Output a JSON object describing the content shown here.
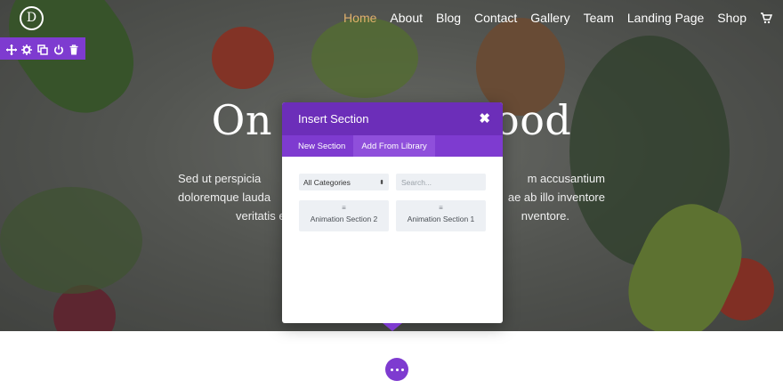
{
  "nav": {
    "items": [
      {
        "label": "Home",
        "active": true
      },
      {
        "label": "About"
      },
      {
        "label": "Blog"
      },
      {
        "label": "Contact"
      },
      {
        "label": "Gallery"
      },
      {
        "label": "Team"
      },
      {
        "label": "Landing Page"
      },
      {
        "label": "Shop"
      }
    ],
    "cart_icon": "cart-icon"
  },
  "logo": {
    "letter": "D"
  },
  "toolbar": {
    "icons": [
      "move-icon",
      "gear-icon",
      "duplicate-icon",
      "power-icon",
      "trash-icon"
    ],
    "color": "#7e3bd0"
  },
  "hero": {
    "title_left": "On",
    "title_right": "ood",
    "lines": [
      {
        "left": "Sed ut perspicia",
        "right": "m accusantium"
      },
      {
        "left": "doloremque lauda",
        "right": "ae ab illo inventore"
      },
      {
        "left": "veritatis e",
        "right": "nventore."
      }
    ]
  },
  "modal": {
    "title": "Insert Section",
    "close_icon": "close-icon",
    "tabs": [
      {
        "label": "New Section",
        "active": false
      },
      {
        "label": "Add From Library",
        "active": true
      }
    ],
    "category_select": {
      "value": "All Categories"
    },
    "search": {
      "placeholder": "Search..."
    },
    "items": [
      {
        "label": "Animation Section 2",
        "icon": "drag-handle-icon"
      },
      {
        "label": "Animation Section 1",
        "icon": "drag-handle-icon"
      }
    ],
    "header_color": "#6c2eb9",
    "tabs_color": "#7e3bd0"
  },
  "add_button": {
    "icon": "more-dots-icon"
  },
  "colors": {
    "accent": "#7e3bd0",
    "nav_active": "#e0b06b"
  }
}
